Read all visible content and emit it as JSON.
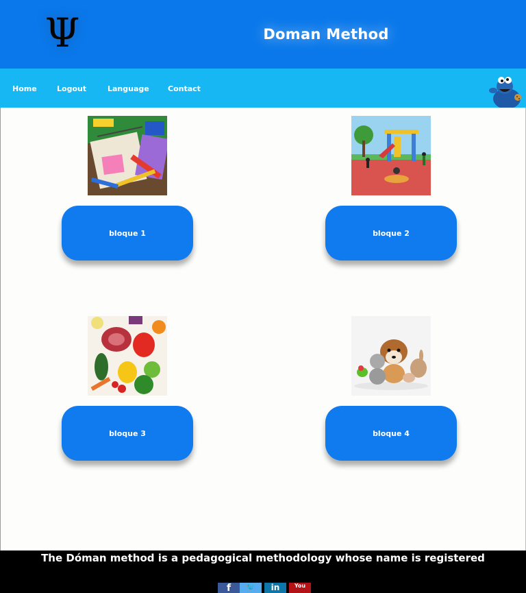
{
  "header": {
    "logo_glyph": "Ψ",
    "title": "Doman Method"
  },
  "nav": {
    "items": [
      {
        "label": "Home"
      },
      {
        "label": "Logout"
      },
      {
        "label": "Language"
      },
      {
        "label": "Contact"
      }
    ]
  },
  "blocks": [
    {
      "label": "bloque 1",
      "image": "school-supplies-image"
    },
    {
      "label": "bloque 2",
      "image": "playground-image"
    },
    {
      "label": "bloque 3",
      "image": "vegetables-image"
    },
    {
      "label": "bloque 4",
      "image": "pets-image"
    }
  ],
  "footer": {
    "text": "The Dóman method is a pedagogical methodology whose name is registered",
    "social": [
      {
        "name": "facebook-icon",
        "glyph": "f",
        "color": "#3b5998"
      },
      {
        "name": "twitter-icon",
        "glyph": "🐦",
        "color": "#55acee"
      },
      {
        "name": "linkedin-icon",
        "glyph": "in",
        "color": "#0e76a8"
      },
      {
        "name": "youtube-icon",
        "glyph": "You",
        "color": "#b31217"
      }
    ]
  },
  "colors": {
    "header_bg": "#0a78ea",
    "nav_bg": "#17b7f3",
    "button_bg": "#0f7bef",
    "footer_bg": "#000000"
  }
}
